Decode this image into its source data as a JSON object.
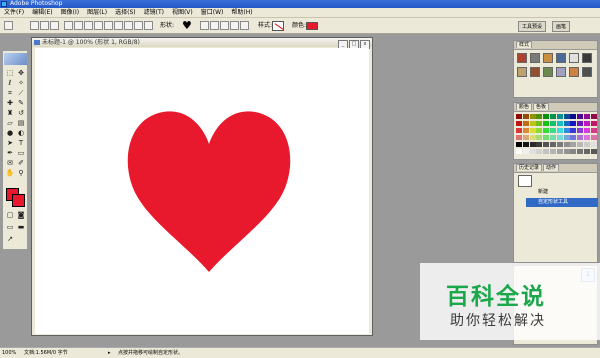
{
  "window": {
    "title": "Adobe Photoshop"
  },
  "menu": [
    "文件(F)",
    "编辑(E)",
    "图像(I)",
    "图层(L)",
    "选择(S)",
    "滤镜(T)",
    "视图(V)",
    "窗口(W)",
    "帮助(H)"
  ],
  "options": {
    "shape_label": "形状:",
    "style_label": "样式:",
    "color_label": "颜色:",
    "shape_icon": "heart-icon",
    "color": "#e8192c",
    "palette_tabs": [
      "工具预设",
      "画笔"
    ]
  },
  "document": {
    "title": "未标题-1 @ 100% (形状 1, RGB/8)",
    "shape_fill": "#e8192c",
    "controls": [
      "_",
      "□",
      "x"
    ]
  },
  "status": {
    "zoom": "100%",
    "doc_info": "文档:1.56M/0 字节",
    "hint": "点按并拖移可绘制自定形状。"
  },
  "panels": {
    "styles_tab": "样式",
    "color_tabs": [
      "颜色",
      "色板"
    ],
    "history_tabs": [
      "历史记录",
      "动作"
    ],
    "history_items": [
      "新建",
      "自定形状工具"
    ],
    "layers_value": "1"
  },
  "colors": {
    "accent_red": "#e8192c",
    "chrome": "#ece9d8",
    "workspace": "#9a9a9a"
  },
  "watermark": {
    "main": "百科全说",
    "sub": "助你轻松解决"
  }
}
